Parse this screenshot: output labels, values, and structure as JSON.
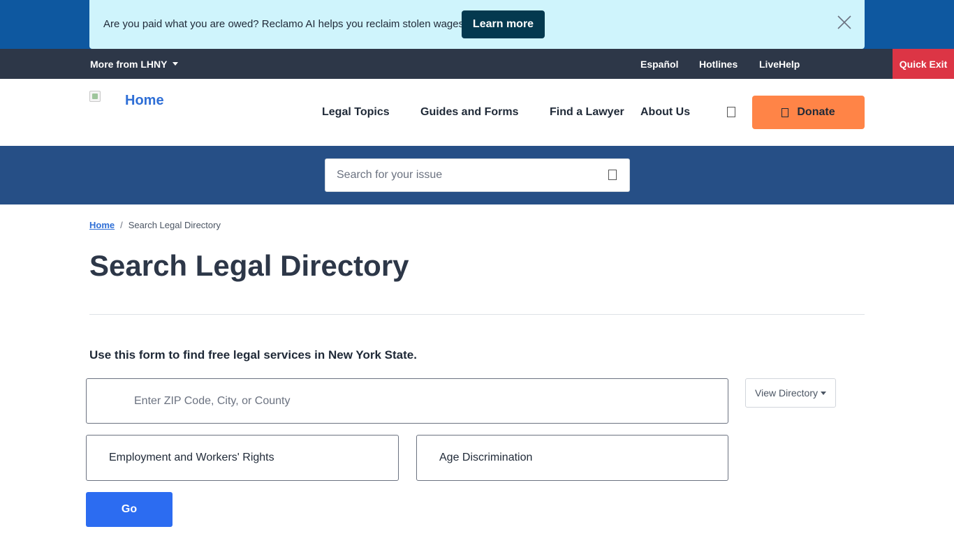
{
  "promo": {
    "text": "Are you paid what you are owed? Reclamo AI helps you reclaim stolen wages.",
    "button_label": "Learn more",
    "close_icon": "close-icon",
    "colors": {
      "band": "#0e58a0",
      "box": "#cff4fc",
      "button": "#04394f"
    }
  },
  "utility_bar": {
    "more_from_label": "More from LHNY",
    "links": [
      "Español",
      "Hotlines",
      "LiveHelp"
    ],
    "quick_exit_label": "Quick Exit",
    "colors": {
      "bar": "#2d3748",
      "quick_exit": "#dc3545"
    }
  },
  "header": {
    "logo_alt": "Home",
    "nav": [
      "Legal Topics",
      "Guides and Forms",
      "Find a Lawyer",
      "About Us"
    ],
    "search_icon": "search-icon",
    "donate_label": "Donate",
    "donate_icon": "heart-icon",
    "colors": {
      "donate": "#ff8447",
      "link": "#2f6fd6"
    }
  },
  "search": {
    "placeholder": "Search for your issue",
    "icon": "search-icon",
    "band_color": "#264f86"
  },
  "breadcrumb": {
    "home": "Home",
    "separator": "/",
    "current": "Search Legal Directory"
  },
  "page": {
    "title": "Search Legal Directory",
    "intro": "Use this form to find free legal services in New York State."
  },
  "form": {
    "location_placeholder": "Enter ZIP Code, City, or County",
    "view_directory_label": "View Directory",
    "category_selected": "Employment and Workers' Rights",
    "subcategory_selected": "Age Discrimination",
    "go_label": "Go",
    "go_color": "#2c6cf1"
  }
}
